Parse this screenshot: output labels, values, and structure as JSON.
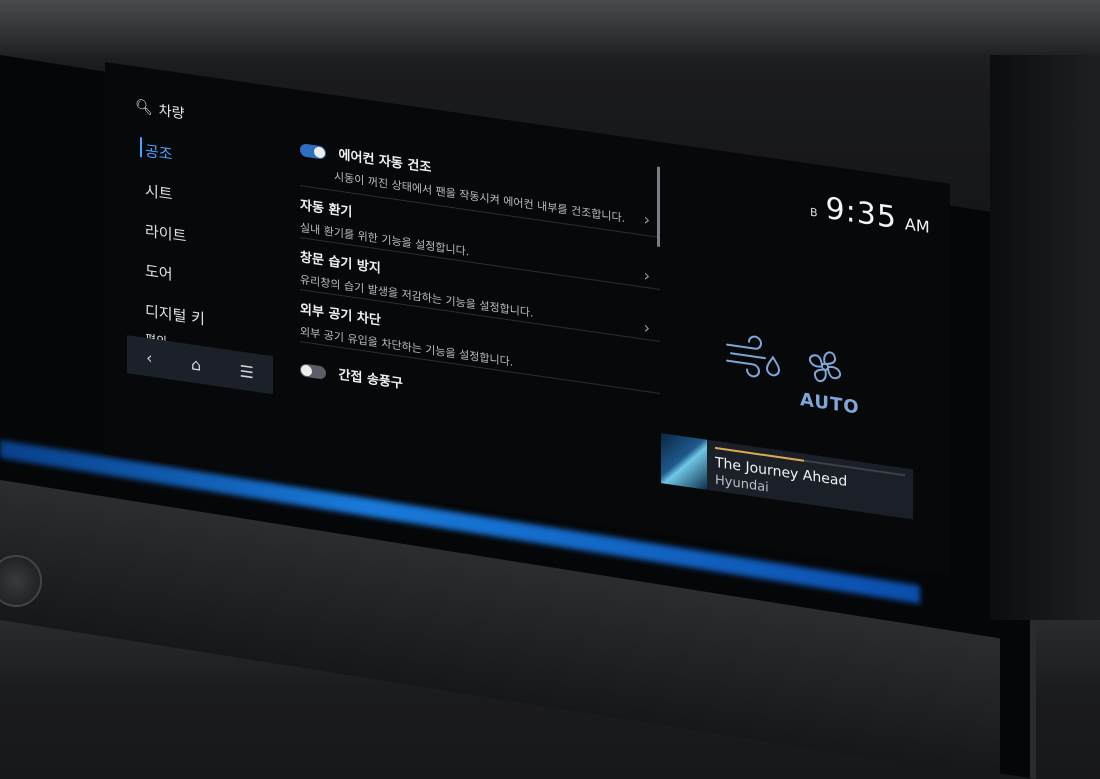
{
  "header": {
    "search_label": "차량"
  },
  "sidebar": {
    "items": [
      {
        "label": "공조",
        "active": true
      },
      {
        "label": "시트",
        "active": false
      },
      {
        "label": "라이트",
        "active": false
      },
      {
        "label": "도어",
        "active": false
      },
      {
        "label": "디지털 키",
        "active": false
      },
      {
        "label": "편의",
        "active": false
      }
    ]
  },
  "navbar": {
    "back": "‹",
    "home": "⌂",
    "menu": "☰"
  },
  "settings": [
    {
      "title": "에어컨 자동 건조",
      "desc": "시동이 꺼진 상태에서 팬을 작동시켜 에어컨 내부를 건조합니다.",
      "toggle": "on"
    },
    {
      "title": "자동 환기",
      "desc": "실내 환기를 위한 기능을 설정합니다."
    },
    {
      "title": "창문 습기 방지",
      "desc": "유리창의 습기 발생을 저감하는 기능을 설정합니다."
    },
    {
      "title": "외부 공기 차단",
      "desc": "외부 공기 유입을 차단하는 기능을 설정합니다."
    },
    {
      "title": "간접 송풍구",
      "toggle": "off"
    }
  ],
  "status": {
    "bluetooth": "B",
    "time": "9:35",
    "ampm": "AM"
  },
  "climate": {
    "mode": "AUTO"
  },
  "media": {
    "title": "The Journey Ahead",
    "artist": "Hyundai",
    "progress": 0.47
  },
  "colors": {
    "accent": "#4aa3ff",
    "ambient": "#1d8fff",
    "toggle_on": "#2e6fc4"
  }
}
